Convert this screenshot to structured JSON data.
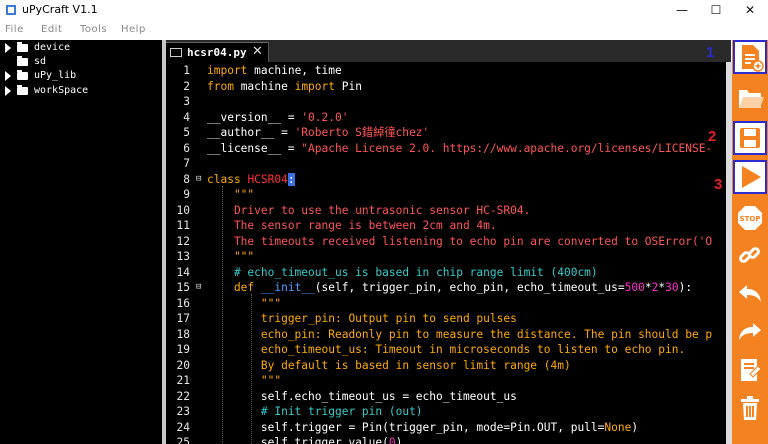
{
  "window": {
    "title": "uPyCraft V1.1",
    "minimize_glyph": "—",
    "maximize_glyph": "☐",
    "close_glyph": "✕"
  },
  "menu": [
    "File",
    "Edit",
    "Tools",
    "Help"
  ],
  "file_tree": [
    "device",
    "sd",
    "uPy_lib",
    "workSpace"
  ],
  "editor": {
    "tab_label": "hcsr04.py",
    "tab_close": "✕",
    "line_numbers": [
      "1",
      "2",
      "3",
      "4",
      "5",
      "6",
      "7",
      "8",
      "9",
      "10",
      "11",
      "12",
      "13",
      "14",
      "15",
      "16",
      "17",
      "18",
      "19",
      "20",
      "21",
      "22",
      "23",
      "24",
      "25"
    ]
  },
  "markers": {
    "one": "1",
    "two": "2",
    "three": "3"
  },
  "toolbar": {
    "icons": [
      "new-file-icon",
      "open-file-icon",
      "save-file-icon",
      "run-icon",
      "stop-icon",
      "connect-icon",
      "undo-icon",
      "redo-icon",
      "syntax-check-icon",
      "clear-icon"
    ]
  },
  "colors": {
    "accent_orange": "#f58220",
    "marker_blue": "#2b2bd0",
    "marker_red": "#e02020"
  }
}
